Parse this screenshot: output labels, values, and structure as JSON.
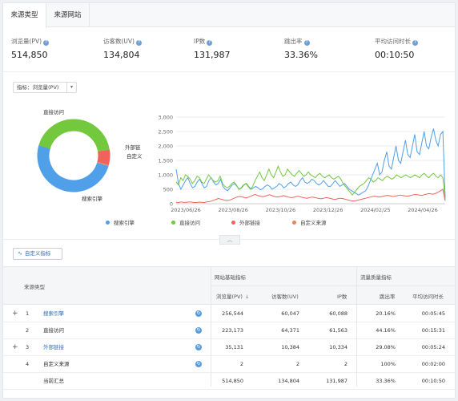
{
  "tabs": [
    "来源类型",
    "来源网站"
  ],
  "metrics": [
    {
      "label": "浏览量(PV)",
      "value": "514,850"
    },
    {
      "label": "访客数(UV)",
      "value": "134,804"
    },
    {
      "label": "IP数",
      "value": "131,987"
    },
    {
      "label": "跳出率",
      "value": "33.36%"
    },
    {
      "label": "平均访问时长",
      "value": "00:10:50"
    }
  ],
  "selector": {
    "prefix": "指标：",
    "value": "浏览量(PV)"
  },
  "donut": {
    "labels": {
      "search": "搜索引擎",
      "direct": "直接访问",
      "external": "外部链",
      "custom": "自定义"
    }
  },
  "chart_data": [
    {
      "type": "pie",
      "categories": [
        "搜索引擎",
        "直接访问",
        "外部链接",
        "自定义来源"
      ],
      "values": [
        256544,
        223173,
        35131,
        2
      ],
      "colors": [
        "#4fa0e8",
        "#73c83d",
        "#f1625a",
        "#e9835f"
      ]
    },
    {
      "type": "line",
      "x_ticks": [
        "2023/06/26",
        "2023/08/26",
        "2023/10/26",
        "2023/12/26",
        "2024/02/25",
        "2024/04/26"
      ],
      "ylim": [
        0,
        3000
      ],
      "y_ticks": [
        "0",
        "500",
        "1,000",
        "1,500",
        "2,000",
        "2,500",
        "3,000"
      ],
      "grid": true,
      "series": [
        {
          "name": "搜索引擎",
          "color": "#4fa0e8",
          "values": [
            1200,
            700,
            500,
            650,
            800,
            900,
            700,
            550,
            600,
            750,
            850,
            700,
            550,
            600,
            800,
            900,
            750,
            650,
            700,
            850,
            600,
            500,
            450,
            550,
            650,
            700,
            600,
            500,
            550,
            650,
            700,
            600,
            500,
            550,
            600,
            550,
            480,
            520,
            600,
            650,
            600,
            500,
            550,
            600,
            700,
            650,
            550,
            600,
            700,
            750,
            650,
            600,
            650,
            800,
            900,
            750,
            700,
            750,
            850,
            800,
            700,
            650,
            700,
            800,
            700,
            600,
            600,
            700,
            800,
            700,
            600,
            650,
            700,
            600,
            500,
            450,
            400,
            350,
            300,
            350,
            400,
            450,
            600,
            800,
            1000,
            1200,
            1400,
            1000,
            1100,
            1500,
            1800,
            1300,
            1200,
            1600,
            2000,
            1500,
            1400,
            1800,
            2200,
            1700,
            1600,
            2000,
            2400,
            1800,
            1700,
            2100,
            2500,
            2000,
            1900,
            2300,
            2600,
            2200,
            2000,
            2400,
            2500,
            200
          ]
        },
        {
          "name": "直接访问",
          "color": "#73c83d",
          "values": [
            750,
            650,
            900,
            800,
            1000,
            950,
            850,
            700,
            800,
            950,
            900,
            750,
            700,
            850,
            1000,
            900,
            800,
            750,
            800,
            950,
            700,
            600,
            550,
            600,
            700,
            750,
            650,
            500,
            550,
            650,
            700,
            600,
            500,
            600,
            800,
            950,
            1100,
            900,
            800,
            1000,
            1200,
            1000,
            900,
            1100,
            1300,
            1100,
            950,
            1000,
            1200,
            1100,
            1000,
            950,
            1050,
            1150,
            1050,
            950,
            1000,
            1100,
            1000,
            950,
            900,
            1000,
            1050,
            950,
            900,
            950,
            1000,
            900,
            850,
            900,
            950,
            850,
            700,
            600,
            500,
            400,
            300,
            400,
            500,
            600,
            650,
            700,
            800,
            900,
            850,
            750,
            800,
            900,
            850,
            800,
            900,
            950,
            900,
            850,
            900,
            1000,
            950,
            900,
            950,
            1000,
            950,
            900,
            950,
            1000,
            950,
            900,
            1000,
            1050,
            950,
            900,
            1000,
            1050,
            950,
            900,
            1000,
            900,
            150
          ]
        },
        {
          "name": "外部链接",
          "color": "#f1625a",
          "values": [
            50,
            40,
            60,
            50,
            45,
            55,
            60,
            50,
            40,
            45,
            55,
            50,
            40,
            60,
            70,
            90,
            120,
            150,
            180,
            160,
            140,
            120,
            110,
            130,
            160,
            200,
            230,
            250,
            240,
            220,
            200,
            230,
            260,
            300,
            320,
            280,
            260,
            240,
            260,
            290,
            310,
            280,
            250,
            230,
            240,
            260,
            280,
            250,
            230,
            210,
            220,
            240,
            260,
            240,
            220,
            200,
            190,
            210,
            230,
            220,
            200,
            180,
            170,
            190,
            210,
            200,
            180,
            160,
            150,
            170,
            190,
            180,
            160,
            140,
            120,
            100,
            90,
            110,
            130,
            150,
            170,
            190,
            210,
            230,
            250,
            260,
            240,
            230,
            250,
            270,
            290,
            280,
            260,
            250,
            270,
            290,
            300,
            280,
            270,
            260,
            280,
            300,
            320,
            310,
            300,
            290,
            310,
            330,
            350,
            340,
            330,
            360,
            400,
            450,
            500,
            100
          ]
        },
        {
          "name": "自定义来源",
          "color": "#e9835f",
          "values": [
            0,
            0,
            0,
            0,
            0,
            0,
            0,
            0,
            0,
            0,
            0,
            0,
            0,
            0,
            0,
            0,
            0,
            0,
            0,
            0,
            0,
            0,
            0,
            0,
            0,
            0,
            0,
            0,
            0,
            0,
            0,
            0,
            0,
            0,
            0,
            0,
            0,
            0,
            0,
            0,
            0,
            0,
            0,
            0,
            0,
            0,
            0,
            0,
            0,
            0,
            0,
            0,
            0,
            0,
            0,
            0,
            0,
            0,
            0,
            0,
            0,
            0,
            0,
            0,
            0,
            0,
            0,
            0,
            0,
            0,
            0,
            0,
            0,
            0,
            0,
            0,
            0,
            0,
            0,
            0,
            0,
            0,
            0,
            0,
            0,
            0,
            0,
            0,
            0,
            0,
            0,
            0,
            0,
            0,
            0,
            0,
            0,
            0,
            0,
            0,
            0,
            0,
            0,
            0,
            0,
            0,
            0,
            0,
            0,
            0,
            0,
            0,
            0,
            0,
            0,
            0
          ]
        }
      ]
    }
  ],
  "legend": [
    "搜索引擎",
    "直接访问",
    "外部链接",
    "自定义来源"
  ],
  "collapse_icon": "chevron-up-icon",
  "custom_metrics_btn": "自定义指标",
  "table": {
    "col_source": "来源类型",
    "group_basic": "网站基础指标",
    "group_quality": "流量质量指标",
    "headers": [
      "浏览量(PV)",
      "访客数(UV)",
      "IP数",
      "跳出率",
      "平均访问时长"
    ],
    "rows": [
      {
        "idx": "1",
        "name": "搜索引擎",
        "link": true,
        "expand": true,
        "pv": "256,544",
        "uv": "60,047",
        "ip": "60,088",
        "bounce": "20.16%",
        "avg": "00:05:45"
      },
      {
        "idx": "2",
        "name": "直接访问",
        "link": false,
        "expand": false,
        "pv": "223,173",
        "uv": "64,371",
        "ip": "61,563",
        "bounce": "44.16%",
        "avg": "00:15:31"
      },
      {
        "idx": "3",
        "name": "外部链接",
        "link": true,
        "expand": true,
        "pv": "35,131",
        "uv": "10,384",
        "ip": "10,334",
        "bounce": "29.08%",
        "avg": "00:05:24"
      },
      {
        "idx": "4",
        "name": "自定义来源",
        "link": false,
        "expand": false,
        "pv": "2",
        "uv": "2",
        "ip": "2",
        "bounce": "100%",
        "avg": "00:02:00"
      }
    ],
    "total": {
      "name": "当前汇总",
      "pv": "514,850",
      "uv": "134,804",
      "ip": "131,987",
      "bounce": "33.36%",
      "avg": "00:10:50"
    }
  }
}
